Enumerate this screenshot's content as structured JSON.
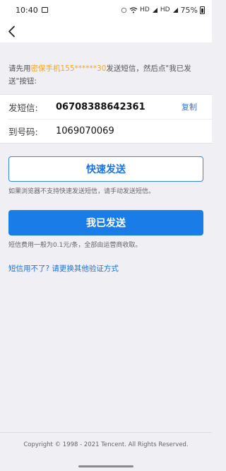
{
  "status_bar": {
    "time": "10:40",
    "battery_percent": "75%",
    "network_1": "HD",
    "network_2": "HD"
  },
  "instruction": {
    "prefix": "请先用",
    "highlight": "密保手机155******30",
    "suffix": "发送短信，然后点\"我已发送\"按钮:"
  },
  "sms": {
    "send_label": "发短信:",
    "send_value": "06708388642361",
    "copy_label": "复制",
    "to_label": "到号码:",
    "to_value": "1069070069"
  },
  "buttons": {
    "quick_send": "快速发送",
    "sent": "我已发送"
  },
  "hints": {
    "browser_unsupported": "如果浏览器不支持快速发送短信，请手动发送短信。",
    "fee": "短信费用一般为0.1元/条，全部由运营商收取。"
  },
  "alt_link": "短信用不了? 请更换其他验证方式",
  "footer": "Copyright © 1998 - 2021 Tencent. All Rights Reserved.",
  "colors": {
    "accent": "#1a7ce6",
    "highlight": "#f5a623",
    "background": "#efeff4"
  }
}
